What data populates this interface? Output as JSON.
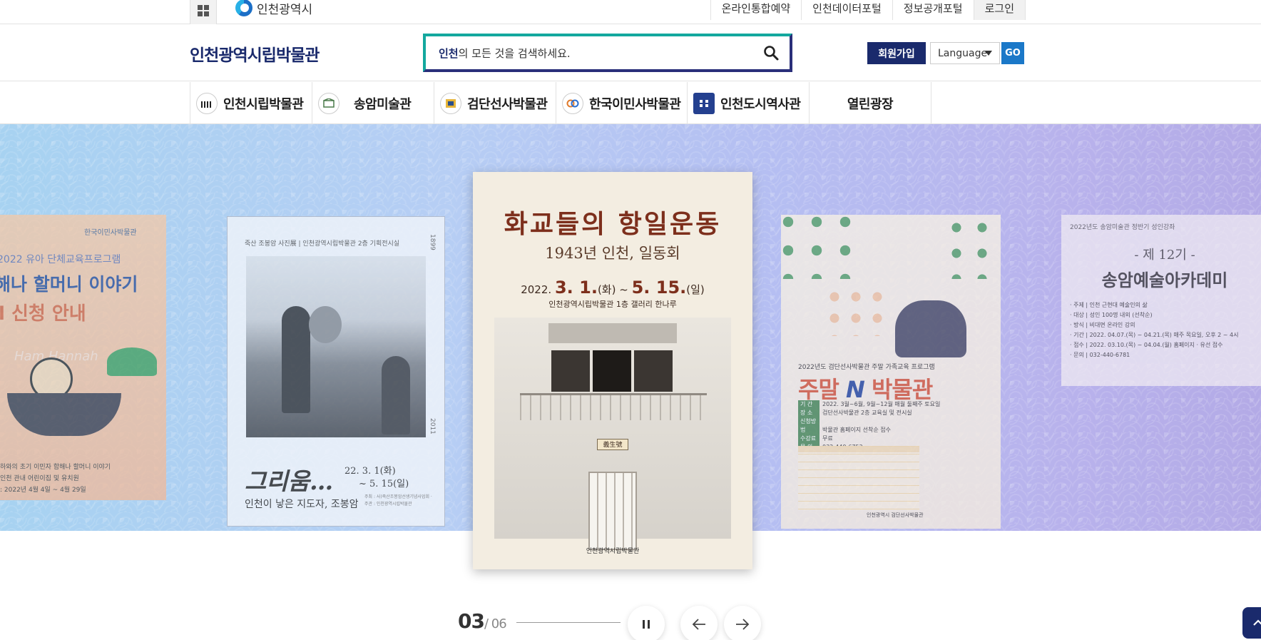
{
  "util": {
    "city_name": "인천광역시",
    "links": [
      "온라인통합예약",
      "인천데이터포털",
      "정보공개포털",
      "로그인"
    ]
  },
  "header": {
    "brand": "인천광역시립박물관",
    "search_bold": "인천",
    "search_rest": "의 모든 것을 검색하세요.",
    "join_label": "회원가입",
    "language_label": "Language",
    "go_label": "GO"
  },
  "gnb": {
    "items": [
      "인천시립박물관",
      "송암미술관",
      "검단선사박물관",
      "한국이민사박물관",
      "인천도시역사관",
      "열린광장"
    ]
  },
  "slides": {
    "p1": {
      "mark": "한국이민사박물관",
      "line1": "2022 유아 단체교육프로그램",
      "line2": "해나 할머니 이야기",
      "line3": "l 신청 안내",
      "line4": "Ham Hannah",
      "line5": "하와의 초기 이민자 함해나 할머니 이야기",
      "line6": "인천 관내 어린이집 및 유치원",
      "line7": ": 2022년 4월 4일 ~ 4월 29일"
    },
    "p2": {
      "header": "죽산 조봉암 사진展 | 인천광역시립박물관 2층 기획전시실",
      "title": "그리움…",
      "subtitle": "인천이 낳은 지도자, 조봉암",
      "date1": "22. 3. 1(화)",
      "date2": "~ 5. 15(일)",
      "fine": "주최 : 사)죽산조봉암선생기념사업회 · 주관 : 인천광역시립박물관",
      "year_top": "1899",
      "year_bottom": "2011"
    },
    "p3": {
      "title": "화교들의 항일운동",
      "subtitle": "1943년 인천, 일동회",
      "date_prefix": "2022.",
      "date_start": "3. 1.",
      "date_mid": "(화) ~",
      "date_end": "5. 15.",
      "date_suffix": "(일)",
      "place": "인천광역시립박물관 1층 갤러리 한나루",
      "sign": "義生號",
      "footer": "인천광역시립박물관"
    },
    "p4": {
      "year_line": "2022년도 검단선사박물관 주말 가족교육 프로그램",
      "title_a": "주말 ",
      "title_b": "N",
      "title_c": " 박물관",
      "rows": [
        "2022. 3월~6월, 9월~12월 매월 둘째주 토요일",
        "검단선사박물관 2층 교육실 및 전시실",
        "박물관 홈페이지 선착순 접수",
        "무료",
        "032-440-6752"
      ],
      "row_labels": [
        "기 간",
        "장 소",
        "신청방법",
        "수강료",
        "문 의"
      ],
      "footer": "인천광역시 검단선사박물관"
    },
    "p5": {
      "header": "2022년도 송암미술관 정반기 성인강좌",
      "title1": "- 제 12기 -",
      "title2": "송암예술아카데미",
      "rows": [
        "· 주제 | 인천 근현대 예술인의 삶",
        "· 대상 | 성인 100명 내외 (선착순)",
        "· 방식 | 비대면 온라인 강의",
        "· 기간 | 2022. 04.07.(목) ~ 04.21.(목) 매주 목요일, 오후 2 ~ 4시",
        "· 접수 | 2022. 03.10.(목) ~ 04.04.(월) 홈페이지 · 유선 접수",
        "· 문의 | 032-440-6781"
      ]
    }
  },
  "slider": {
    "current": "03",
    "total": "/ 06"
  },
  "colors": {
    "navy": "#1a2a6c",
    "teal": "#13a89e",
    "go_blue": "#1b78c8"
  }
}
